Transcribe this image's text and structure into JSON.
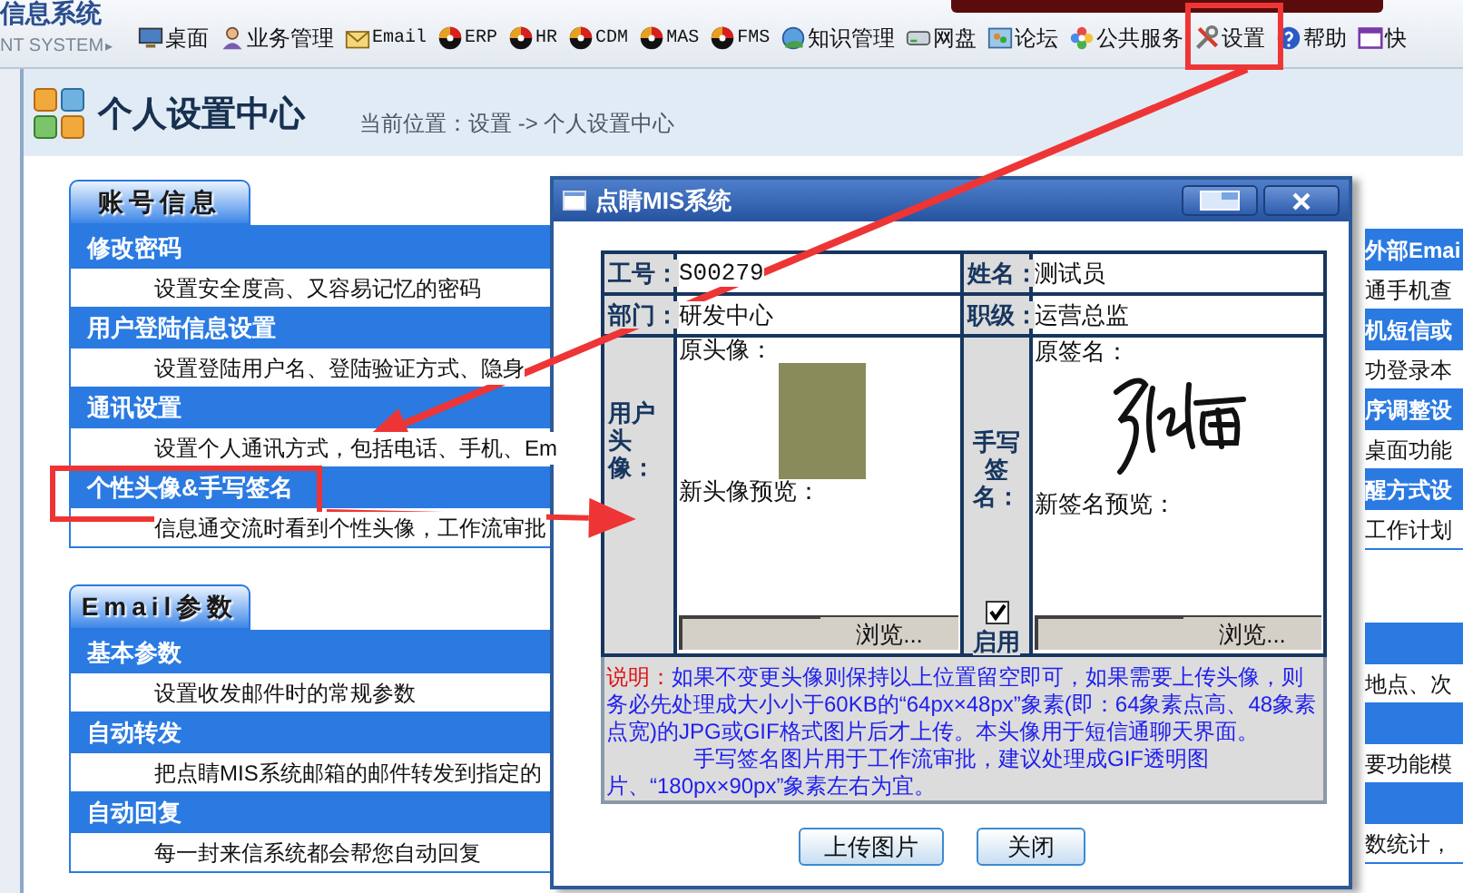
{
  "app": {
    "title": "信息系统",
    "subtitle": "NT SYSTEM",
    "subtitle_arrow": "▸"
  },
  "nav": [
    {
      "label": "桌面",
      "kind": "monitor"
    },
    {
      "label": "业务管理",
      "kind": "user"
    },
    {
      "label": "Email",
      "kind": "mail"
    },
    {
      "label": "ERP",
      "kind": "ball"
    },
    {
      "label": "HR",
      "kind": "ball"
    },
    {
      "label": "CDM",
      "kind": "ball"
    },
    {
      "label": "MAS",
      "kind": "ball"
    },
    {
      "label": "FMS",
      "kind": "ball"
    },
    {
      "label": "知识管理",
      "kind": "globe"
    },
    {
      "label": "网盘",
      "kind": "disk"
    },
    {
      "label": "论坛",
      "kind": "people"
    },
    {
      "label": "公共服务",
      "kind": "flower"
    },
    {
      "label": "设置",
      "kind": "tools"
    },
    {
      "label": "帮助",
      "kind": "help"
    },
    {
      "label": "快",
      "kind": "window"
    }
  ],
  "page": {
    "title": "个人设置中心",
    "breadcrumb": "当前位置：设置 -> 个人设置中心"
  },
  "left_panels": [
    {
      "tab": "账号信息",
      "items": [
        {
          "title": "修改密码",
          "description": "设置安全度高、又容易记忆的密码"
        },
        {
          "title": "用户登陆信息设置",
          "description": "设置登陆用户名、登陆验证方式、隐身"
        },
        {
          "title": "通讯设置",
          "description": "设置个人通讯方式，包括电话、手机、Em"
        },
        {
          "title": "个性头像&手写签名",
          "description": "信息通交流时看到个性头像，工作流审批"
        }
      ]
    },
    {
      "tab": "Email参数",
      "items": [
        {
          "title": "基本参数",
          "description": "设置收发邮件时的常规参数"
        },
        {
          "title": "自动转发",
          "description": "把点睛MIS系统邮箱的邮件转发到指定的"
        },
        {
          "title": "自动回复",
          "description": "每一封来信系统都会帮您自动回复"
        }
      ]
    }
  ],
  "right_panels": [
    {
      "items": [
        {
          "title": "外部Emai",
          "description": "通手机查"
        },
        {
          "title": "机短信或",
          "description": "功登录本"
        },
        {
          "title": "序调整设",
          "description": "桌面功能"
        },
        {
          "title": "醒方式设",
          "description": "工作计划"
        }
      ]
    },
    {
      "items": [
        {
          "description": "地点、次"
        },
        {
          "description": "要功能模"
        },
        {
          "description": "数统计，"
        }
      ]
    }
  ],
  "dialog": {
    "title": "点睛MIS系统",
    "fields": [
      {
        "label": "工号：",
        "value": "S00279"
      },
      {
        "label": "姓名：",
        "value": "测试员"
      },
      {
        "label": "部门：",
        "value": "研发中心"
      },
      {
        "label": "职级：",
        "value": "运营总监"
      }
    ],
    "avatar": {
      "label": "用户头像：",
      "original_label": "原头像：",
      "preview_label": "新头像预览：",
      "browse": "浏览..."
    },
    "signature": {
      "label": "手写签名：",
      "enabled": true,
      "enabled_label": "启用",
      "original_label": "原签名：",
      "preview_label": "新签名预览：",
      "browse": "浏览..."
    },
    "note": {
      "label": "说明：",
      "paragraphs": [
        "如果不变更头像则保持以上位置留空即可，如果需要上传头像，则务必先处理成大小小于60KB的“64px×48px”象素(即：64象素点高、48象素点宽)的JPG或GIF格式图片后才上传。本头像用于短信通聊天界面。",
        "手写签名图片用于工作流审批，建议处理成GIF透明图片、“180px×90px”象素左右为宜。"
      ]
    },
    "buttons": [
      "上传图片",
      "关闭"
    ]
  }
}
